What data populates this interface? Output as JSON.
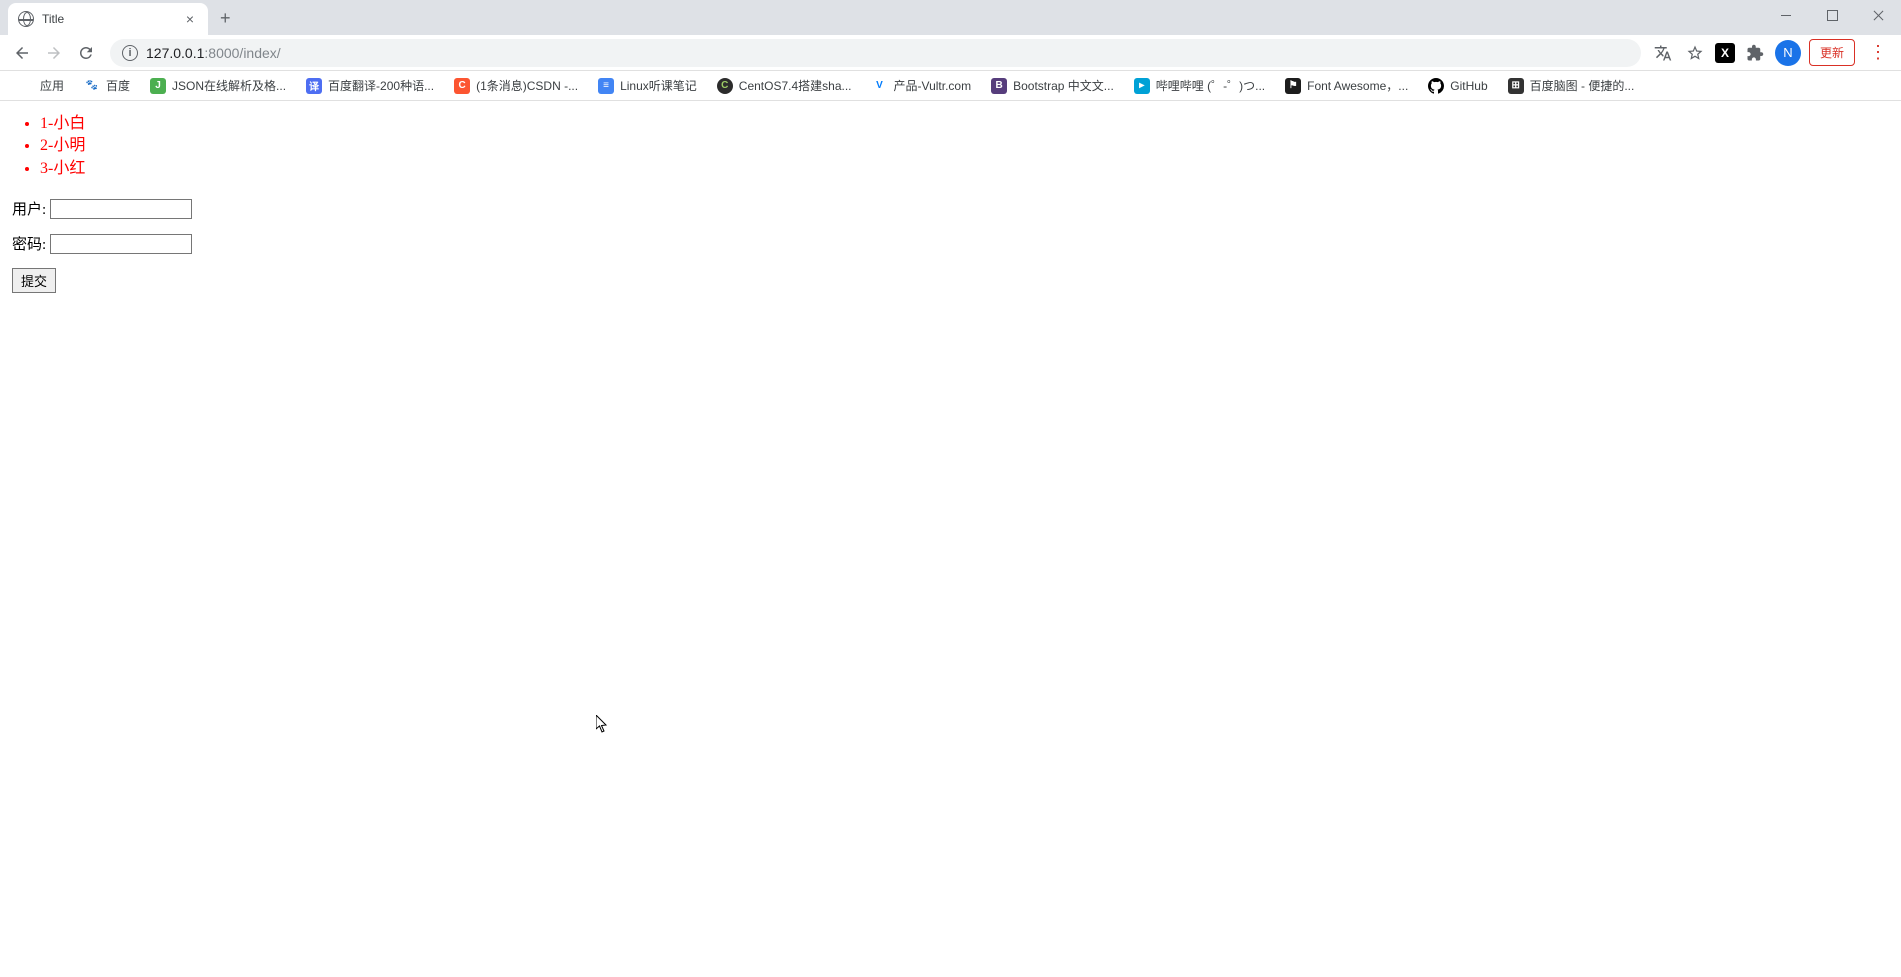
{
  "tab": {
    "title": "Title"
  },
  "address": {
    "host": "127.0.0.1",
    "port_path": ":8000/index/"
  },
  "avatar_letter": "N",
  "update_label": "更新",
  "bookmarks": {
    "apps": "应用",
    "items": [
      {
        "label": "百度",
        "icon_bg": "#3388ff",
        "icon_text": ""
      },
      {
        "label": "JSON在线解析及格...",
        "icon_bg": "#4caf50",
        "icon_text": ""
      },
      {
        "label": "百度翻译-200种语...",
        "icon_bg": "#4e6ef2",
        "icon_text": "译"
      },
      {
        "label": "(1条消息)CSDN -...",
        "icon_bg": "#fc5531",
        "icon_text": "C"
      },
      {
        "label": "Linux听课笔记",
        "icon_bg": "#4285f4",
        "icon_text": ""
      },
      {
        "label": "CentOS7.4搭建sha...",
        "icon_bg": "#2c2c2c",
        "icon_text": "C"
      },
      {
        "label": "产品-Vultr.com",
        "icon_bg": "#007bfc",
        "icon_text": "V"
      },
      {
        "label": "Bootstrap 中文文...",
        "icon_bg": "#563d7c",
        "icon_text": "B"
      },
      {
        "label": "哔哩哔哩 (゜-゜)つ...",
        "icon_bg": "#00a1d6",
        "icon_text": ""
      },
      {
        "label": "Font Awesome，...",
        "icon_bg": "#1d1d1d",
        "icon_text": ""
      },
      {
        "label": "GitHub",
        "icon_bg": "#000",
        "icon_text": ""
      },
      {
        "label": "百度脑图 - 便捷的...",
        "icon_bg": "#333",
        "icon_text": ""
      }
    ]
  },
  "list_items": [
    "1-小白",
    "2-小明",
    "3-小红"
  ],
  "form": {
    "user_label": "用户:",
    "password_label": "密码:",
    "submit_label": "提交"
  }
}
